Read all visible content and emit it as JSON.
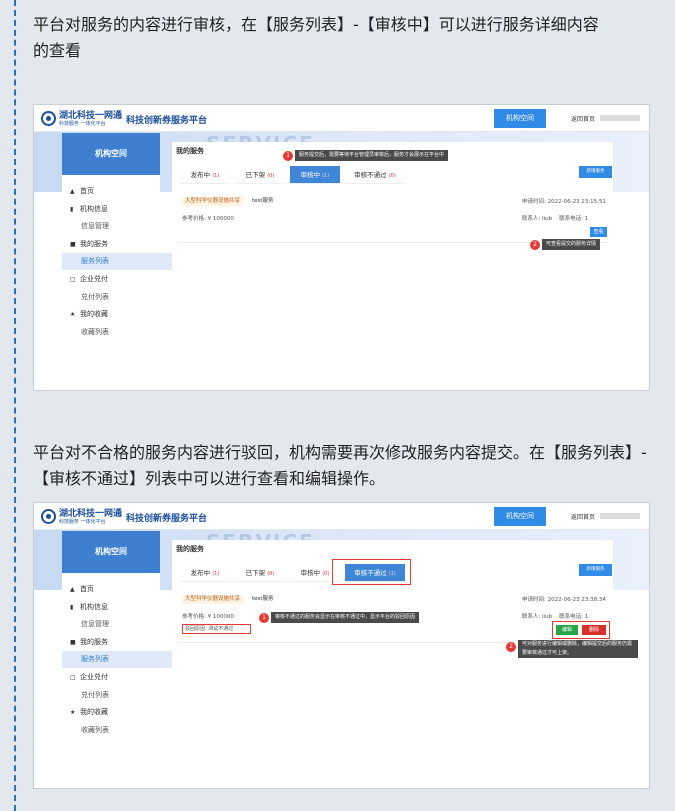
{
  "intro1": "平台对服务的内容进行审核，在【服务列表】-【审核中】可以进行服务详细内容\n的查看",
  "intro2": "平台对不合格的服务内容进行驳回，机构需要再次修改服务内容提交。在【服务列表】-【审核不通过】列表中可以进行查看和编辑操作。",
  "common": {
    "logo_name": "湖北科技一网通",
    "logo_sub": "科技服务 一体化平台",
    "platform_title": "科技创新券服务平台",
    "org_space_btn": "机构空间",
    "watermark": "SERVICE",
    "side_head": "机构空间",
    "panel_title": "我的服务",
    "new_btn": "新增服务",
    "sidebar": [
      {
        "label": "首页",
        "icon": "home-icon",
        "glyph": "▲",
        "type": "parent"
      },
      {
        "label": "机构信息",
        "icon": "bar-chart-icon",
        "glyph": "▮",
        "type": "parent"
      },
      {
        "label": "信息管理",
        "type": "child"
      },
      {
        "label": "我的服务",
        "icon": "grid-icon",
        "glyph": "■",
        "type": "parent"
      },
      {
        "label": "服务列表",
        "type": "child",
        "active": true
      },
      {
        "label": "企业兑付",
        "icon": "square-icon",
        "glyph": "□",
        "type": "parent"
      },
      {
        "label": "兑付列表",
        "type": "child"
      },
      {
        "label": "我的收藏",
        "icon": "star-icon",
        "glyph": "★",
        "type": "parent"
      },
      {
        "label": "收藏列表",
        "type": "child"
      }
    ],
    "tabs": [
      {
        "label": "发布中",
        "count": "(1)"
      },
      {
        "label": "已下架",
        "count": "(0)"
      },
      {
        "label": "审核中",
        "count": "(1)"
      },
      {
        "label": "审核不通过",
        "count": "(0)"
      }
    ],
    "service_tag": "大型科学仪器设施共享",
    "service_name": "test服务",
    "ref_price": "参考价格:  ¥ 100000",
    "contact": "联系人:  liub",
    "contact_phone": "联系电话:  1"
  },
  "shot1": {
    "home_link": "返回首页",
    "req_time": "申请时间:  2022-06-23 23:15:51",
    "view_btn": "查看",
    "callout1": "服务提交后，需要等待平台管理员审核后，服务才会展示在平台中",
    "callout2": "可查看提交的服务详情",
    "badge1": "1",
    "badge2": "2"
  },
  "shot2": {
    "home_link": "返回首页",
    "req_time": "申请时间:  2022-06-23 23:38:34",
    "tab4_count": "(1)",
    "tab3_count": "(0)",
    "reject_reason": "驳回原因:  测试不通过",
    "edit_btn": "编辑",
    "delete_btn": "删除",
    "callout1": "审核不通过的服务会显示在审核不通过中，显示平台的驳回原因",
    "callout2": "可对服务进行编辑或删除，编辑提交后的服务仍需要审核通过才可上架。",
    "badge1": "1",
    "badge2": "2"
  },
  "colors": {
    "accent": "#2f8be6",
    "tab_active": "#3f86d8",
    "highlight_red": "#e53935",
    "edit_green": "#27a34a",
    "delete_red": "#d9302c"
  }
}
